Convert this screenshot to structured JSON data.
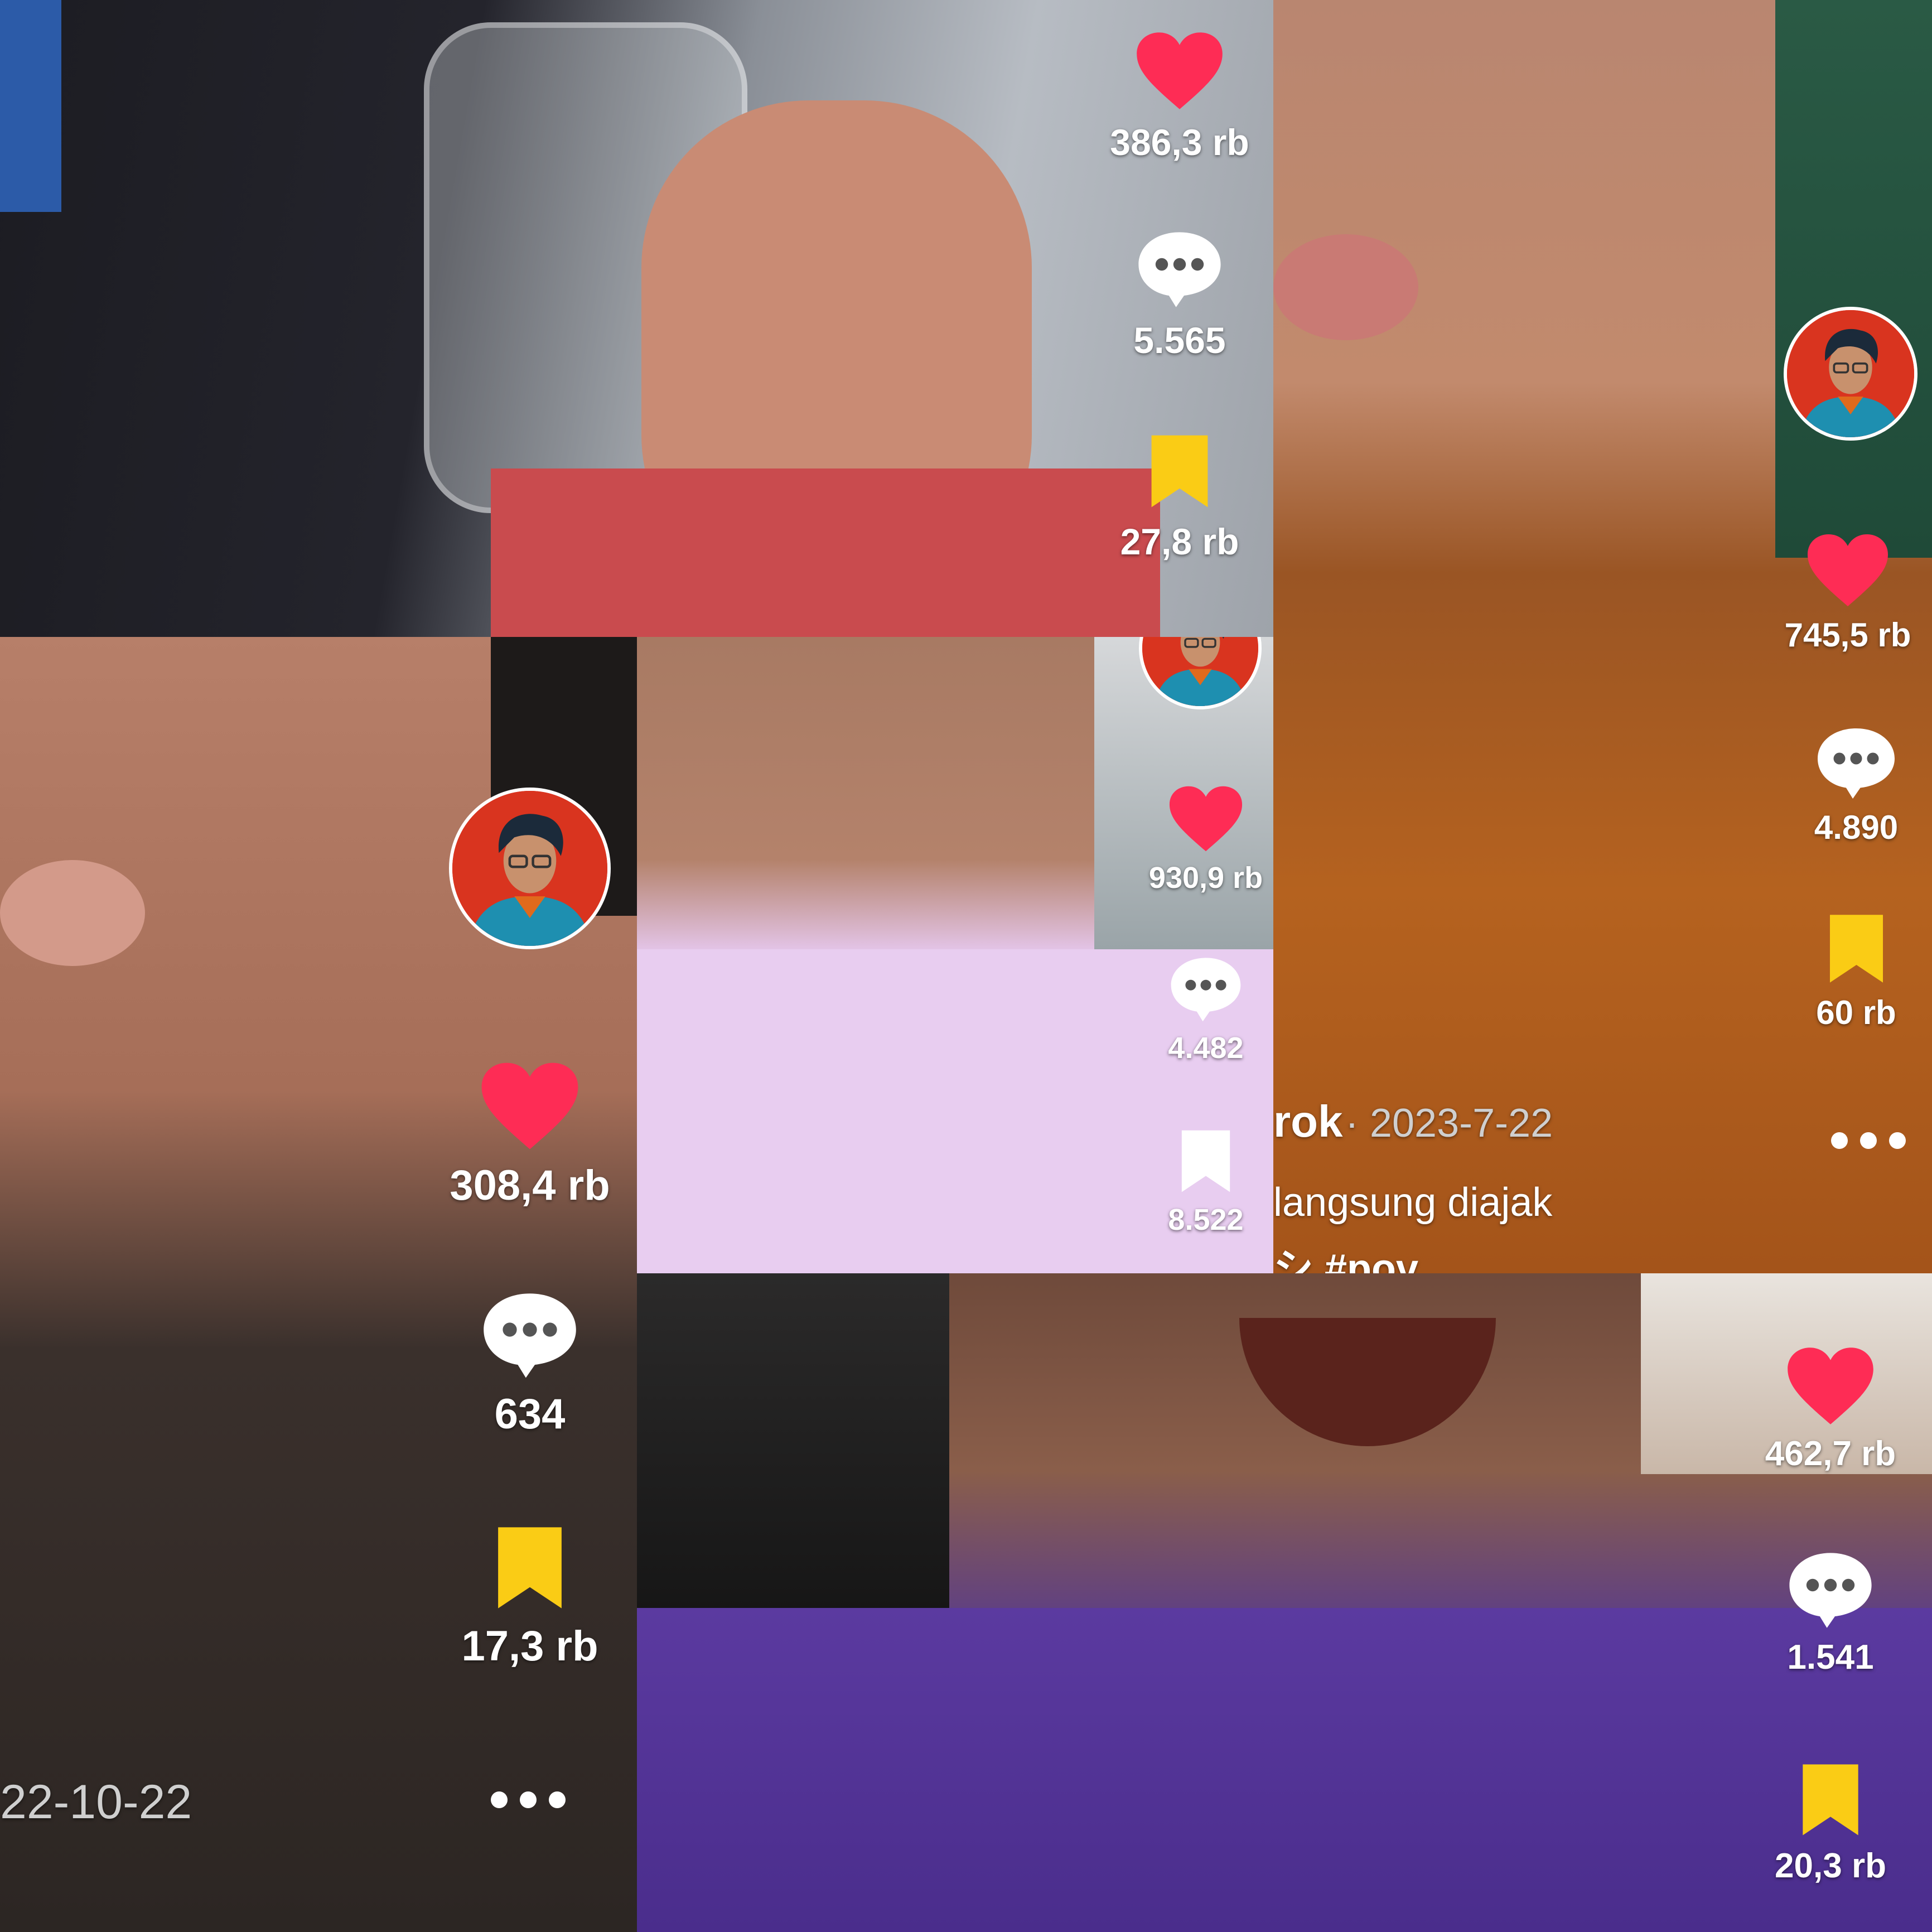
{
  "panels": [
    {
      "likes": "386,3 rb",
      "comments": "5.565",
      "saves": "27,8 rb"
    },
    {
      "likes": "745,5 rb",
      "comments": "4.890",
      "saves": "60 rb",
      "meta_user": "rok",
      "meta_date": "· 2023-7-22",
      "caption_line1": "langsung diajak",
      "caption_line2": "シ #pov"
    },
    {
      "likes": "308,4 rb",
      "comments": "634",
      "saves": "17,3 rb",
      "meta_date": "22-10-22"
    },
    {
      "likes": "930,9 rb",
      "comments": "4.482",
      "saves": "8.522"
    },
    {
      "likes": "462,7 rb",
      "comments": "1.541",
      "saves": "20,3 rb"
    }
  ],
  "colors": {
    "like": "#fe2c55",
    "saved": "#facc15",
    "unsaved": "#ffffff"
  },
  "icons": [
    "heart-icon",
    "comment-bubble-icon",
    "bookmark-icon",
    "more-dots-icon",
    "creator-avatar"
  ]
}
